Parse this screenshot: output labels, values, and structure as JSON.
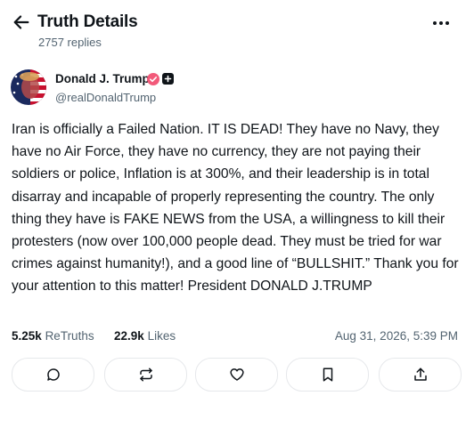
{
  "header": {
    "title": "Truth Details",
    "reply_count": "2757 replies",
    "back_icon": "arrow-left-icon",
    "more_icon": "more-horizontal-icon"
  },
  "author": {
    "name": "Donald J. Trump",
    "handle": "@realDonaldTrump",
    "verified_color": "#f25a7a"
  },
  "post": {
    "text": "Iran is officially a Failed Nation. IT IS DEAD! They have no Navy, they have no Air Force, they have no currency, they are not paying their soldiers or police, Inflation is at 300%, and their leadership is in total disarray and incapable of properly representing the country. The only thing they have is FAKE NEWS from the USA, a willingness to kill their protesters (now over 100,000 people dead. They must be tried for war crimes against humanity!), and a good line of “BULLSHIT.” Thank you for your attention to this matter! President DONALD J.TRUMP"
  },
  "stats": {
    "retruths_count": "5.25k",
    "retruths_label": "ReTruths",
    "likes_count": "22.9k",
    "likes_label": "Likes",
    "timestamp": "Aug 31, 2026, 5:39 PM"
  },
  "actions": [
    {
      "icon": "reply-icon"
    },
    {
      "icon": "retruth-icon"
    },
    {
      "icon": "like-heart-icon"
    },
    {
      "icon": "bookmark-icon"
    },
    {
      "icon": "share-icon"
    }
  ]
}
